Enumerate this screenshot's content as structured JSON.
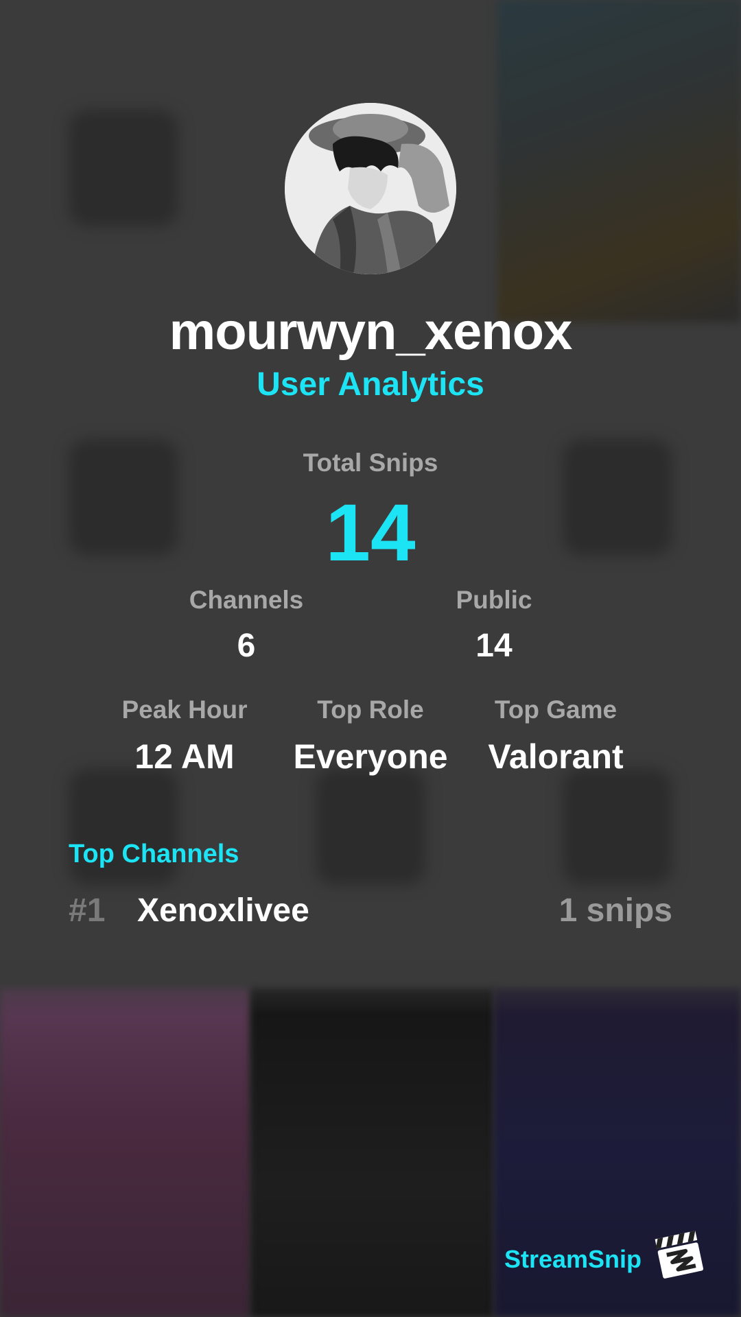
{
  "profile": {
    "username": "mourwyn_xenox",
    "subtitle": "User Analytics"
  },
  "stats": {
    "total": {
      "label": "Total Snips",
      "value": "14"
    },
    "channels": {
      "label": "Channels",
      "value": "6"
    },
    "public": {
      "label": "Public",
      "value": "14"
    },
    "peak_hour": {
      "label": "Peak Hour",
      "value": "12 AM"
    },
    "top_role": {
      "label": "Top Role",
      "value": "Everyone"
    },
    "top_game": {
      "label": "Top Game",
      "value": "Valorant"
    }
  },
  "top_channels": {
    "title": "Top Channels",
    "items": [
      {
        "rank": "#1",
        "name": "Xenoxlivee",
        "count": "1 snips"
      }
    ]
  },
  "brand": {
    "name": "StreamSnip"
  },
  "colors": {
    "accent": "#1ce4f4",
    "background": "#3a3a3a",
    "label": "#a8a8a8",
    "text": "#ffffff"
  },
  "icons": {
    "avatar": "avatar-image",
    "logo": "streamsnip-logo-icon"
  }
}
